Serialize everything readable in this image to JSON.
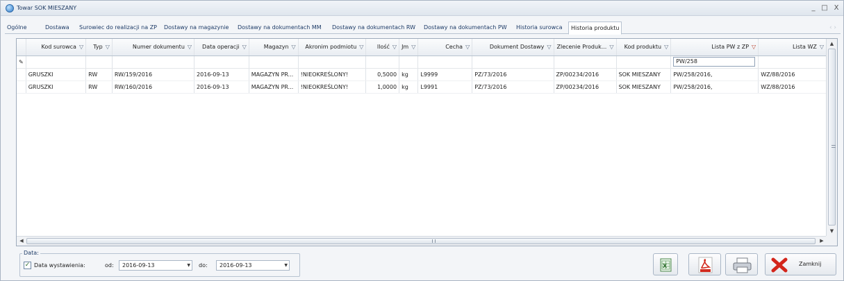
{
  "window": {
    "title": "Towar SOK MIESZANY",
    "controls": [
      "_",
      "□",
      "X"
    ]
  },
  "tabs": [
    {
      "label": "Ogólne"
    },
    {
      "label": "Dostawa"
    },
    {
      "label": "Surowiec do realizacji na ZP"
    },
    {
      "label": "Dostawy na magazynie"
    },
    {
      "label": "Dostawy na dokumentach MM"
    },
    {
      "label": "Dostawy na dokumentach RW"
    },
    {
      "label": "Dostawy na dokumentach PW"
    },
    {
      "label": "Historia surowca"
    },
    {
      "label": "Historia produktu"
    }
  ],
  "active_tab": "Historia produktu",
  "grid": {
    "columns": [
      "Kod surowca",
      "Typ",
      "Numer dokumentu",
      "Data operacji",
      "Magazyn",
      "Akronim podmiotu",
      "Ilość",
      "Jm",
      "Cecha",
      "Dokument Dostawy",
      "Zlecenie Produk...",
      "Kod produktu",
      "Lista PW z ZP",
      "Lista WZ"
    ],
    "filter_icon": "funnel-icon",
    "filter_row": {
      "edit_icon": "pencil-icon",
      "lista_pw_value": "PW/258"
    },
    "rows": [
      [
        "GRUSZKI",
        "RW",
        "RW/159/2016",
        "2016-09-13",
        "MAGAZYN PR...",
        "!NIEOKREŚLONY!",
        "0,5000",
        "kg",
        "L9999",
        "PZ/73/2016",
        "ZP/00234/2016",
        "SOK MIESZANY",
        "PW/258/2016,",
        "WZ/88/2016"
      ],
      [
        "GRUSZKI",
        "RW",
        "RW/160/2016",
        "2016-09-13",
        "MAGAZYN PR...",
        "!NIEOKREŚLONY!",
        "1,0000",
        "kg",
        "L9991",
        "PZ/73/2016",
        "ZP/00234/2016",
        "SOK MIESZANY",
        "PW/258/2016,",
        "WZ/88/2016"
      ]
    ]
  },
  "date_filter": {
    "group_label": "Data:",
    "checkbox_label": "Data wystawienia:",
    "checked": true,
    "from_label": "od:",
    "from_value": "2016-09-13",
    "to_label": "do:",
    "to_value": "2016-09-13"
  },
  "buttons": {
    "excel_icon": "excel-export-icon",
    "pdf_icon": "pdf-export-icon",
    "print_icon": "printer-icon",
    "close_label": "Zamknij"
  }
}
